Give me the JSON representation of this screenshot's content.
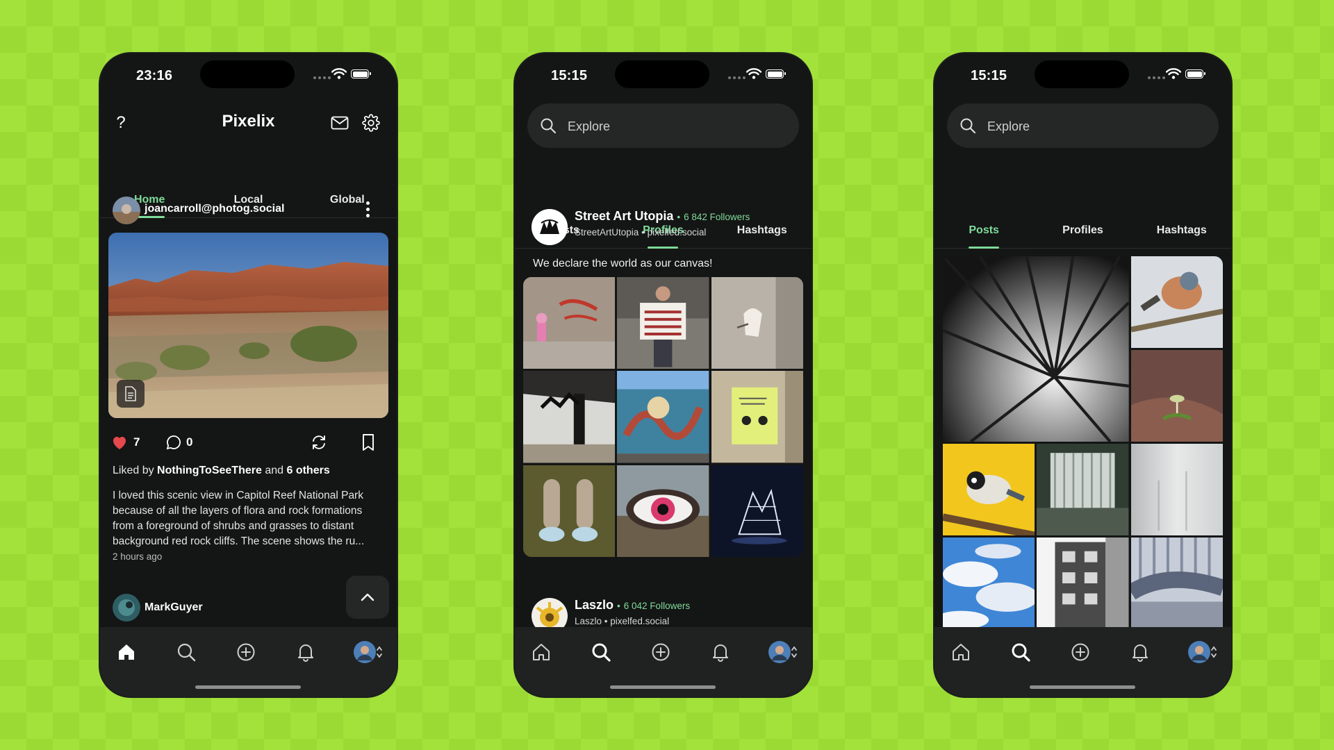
{
  "colors": {
    "accent": "#7fdb9a",
    "background": "#141515",
    "like": "#e5484d",
    "backdrop": "#a2e23b"
  },
  "phone1": {
    "time": "23:16",
    "title": "Pixelix",
    "tabs": [
      {
        "label": "Home"
      },
      {
        "label": "Local"
      },
      {
        "label": "Global"
      }
    ],
    "active_tab": "Home",
    "post": {
      "author": "joancarroll@photog.social",
      "likes": "7",
      "comments": "0",
      "liked_by_prefix": "Liked by",
      "liked_by_user": "NothingToSeeThere",
      "liked_by_and": "and",
      "liked_by_others": "6 others",
      "caption_lines": [
        "I loved this scenic view in Capitol Reef National Park",
        "because of all the layers of flora and rock formations",
        "from a foreground of shrubs and grasses to distant",
        "background red rock cliffs. The scene shows the ru..."
      ],
      "time_ago": "2 hours ago"
    },
    "next_post_author": "MarkGuyer"
  },
  "phone2": {
    "time": "15:15",
    "search_placeholder": "Explore",
    "tabs": [
      {
        "label": "Posts"
      },
      {
        "label": "Profiles"
      },
      {
        "label": "Hashtags"
      }
    ],
    "active_tab": "Profiles",
    "profiles": [
      {
        "name": "Street Art Utopia",
        "followers": "6 842 Followers",
        "handle": "StreetArtUtopia",
        "instance": "pixelfed.social",
        "bio": "We declare the world as our canvas!"
      },
      {
        "name": "Laszlo",
        "followers": "6 042 Followers",
        "handle": "Laszlo",
        "instance": "pixelfed.social"
      }
    ],
    "separator": "•"
  },
  "phone3": {
    "time": "15:15",
    "search_placeholder": "Explore",
    "tabs": [
      {
        "label": "Posts"
      },
      {
        "label": "Profiles"
      },
      {
        "label": "Hashtags"
      }
    ],
    "active_tab": "Posts"
  },
  "icons": {
    "help": "help-icon",
    "mail": "mail-icon",
    "settings": "gear-icon",
    "more": "more-vertical-icon",
    "heart": "heart-icon",
    "comment": "comment-icon",
    "boost": "boost-icon",
    "bookmark": "bookmark-icon",
    "home": "home-icon",
    "search": "search-icon",
    "add": "add-circle-icon",
    "bell": "bell-icon"
  }
}
